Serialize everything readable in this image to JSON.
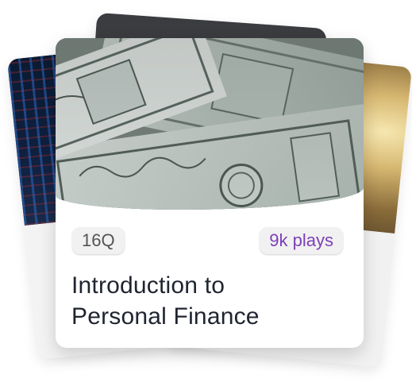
{
  "quiz_card": {
    "questions_badge": "16Q",
    "plays_badge": "9k plays",
    "title_line_1": "Introduction to",
    "title_line_2": "Personal Finance",
    "image_icon": "dollar-bills-image"
  },
  "colors": {
    "plays_text": "#7c40b8",
    "badge_bg": "#f1f1f1",
    "title_text": "#1f2430",
    "card_bg": "#ffffff"
  }
}
